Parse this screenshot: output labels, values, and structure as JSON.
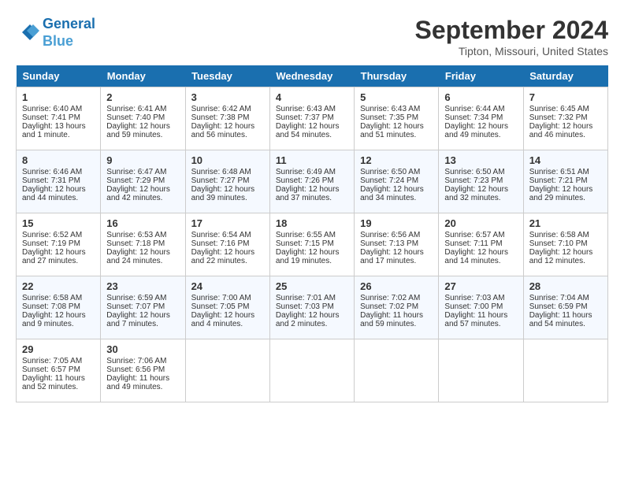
{
  "header": {
    "logo_line1": "General",
    "logo_line2": "Blue",
    "month": "September 2024",
    "location": "Tipton, Missouri, United States"
  },
  "days_of_week": [
    "Sunday",
    "Monday",
    "Tuesday",
    "Wednesday",
    "Thursday",
    "Friday",
    "Saturday"
  ],
  "weeks": [
    [
      {
        "day": "1",
        "info": "Sunrise: 6:40 AM\nSunset: 7:41 PM\nDaylight: 13 hours\nand 1 minute."
      },
      {
        "day": "2",
        "info": "Sunrise: 6:41 AM\nSunset: 7:40 PM\nDaylight: 12 hours\nand 59 minutes."
      },
      {
        "day": "3",
        "info": "Sunrise: 6:42 AM\nSunset: 7:38 PM\nDaylight: 12 hours\nand 56 minutes."
      },
      {
        "day": "4",
        "info": "Sunrise: 6:43 AM\nSunset: 7:37 PM\nDaylight: 12 hours\nand 54 minutes."
      },
      {
        "day": "5",
        "info": "Sunrise: 6:43 AM\nSunset: 7:35 PM\nDaylight: 12 hours\nand 51 minutes."
      },
      {
        "day": "6",
        "info": "Sunrise: 6:44 AM\nSunset: 7:34 PM\nDaylight: 12 hours\nand 49 minutes."
      },
      {
        "day": "7",
        "info": "Sunrise: 6:45 AM\nSunset: 7:32 PM\nDaylight: 12 hours\nand 46 minutes."
      }
    ],
    [
      {
        "day": "8",
        "info": "Sunrise: 6:46 AM\nSunset: 7:31 PM\nDaylight: 12 hours\nand 44 minutes."
      },
      {
        "day": "9",
        "info": "Sunrise: 6:47 AM\nSunset: 7:29 PM\nDaylight: 12 hours\nand 42 minutes."
      },
      {
        "day": "10",
        "info": "Sunrise: 6:48 AM\nSunset: 7:27 PM\nDaylight: 12 hours\nand 39 minutes."
      },
      {
        "day": "11",
        "info": "Sunrise: 6:49 AM\nSunset: 7:26 PM\nDaylight: 12 hours\nand 37 minutes."
      },
      {
        "day": "12",
        "info": "Sunrise: 6:50 AM\nSunset: 7:24 PM\nDaylight: 12 hours\nand 34 minutes."
      },
      {
        "day": "13",
        "info": "Sunrise: 6:50 AM\nSunset: 7:23 PM\nDaylight: 12 hours\nand 32 minutes."
      },
      {
        "day": "14",
        "info": "Sunrise: 6:51 AM\nSunset: 7:21 PM\nDaylight: 12 hours\nand 29 minutes."
      }
    ],
    [
      {
        "day": "15",
        "info": "Sunrise: 6:52 AM\nSunset: 7:19 PM\nDaylight: 12 hours\nand 27 minutes."
      },
      {
        "day": "16",
        "info": "Sunrise: 6:53 AM\nSunset: 7:18 PM\nDaylight: 12 hours\nand 24 minutes."
      },
      {
        "day": "17",
        "info": "Sunrise: 6:54 AM\nSunset: 7:16 PM\nDaylight: 12 hours\nand 22 minutes."
      },
      {
        "day": "18",
        "info": "Sunrise: 6:55 AM\nSunset: 7:15 PM\nDaylight: 12 hours\nand 19 minutes."
      },
      {
        "day": "19",
        "info": "Sunrise: 6:56 AM\nSunset: 7:13 PM\nDaylight: 12 hours\nand 17 minutes."
      },
      {
        "day": "20",
        "info": "Sunrise: 6:57 AM\nSunset: 7:11 PM\nDaylight: 12 hours\nand 14 minutes."
      },
      {
        "day": "21",
        "info": "Sunrise: 6:58 AM\nSunset: 7:10 PM\nDaylight: 12 hours\nand 12 minutes."
      }
    ],
    [
      {
        "day": "22",
        "info": "Sunrise: 6:58 AM\nSunset: 7:08 PM\nDaylight: 12 hours\nand 9 minutes."
      },
      {
        "day": "23",
        "info": "Sunrise: 6:59 AM\nSunset: 7:07 PM\nDaylight: 12 hours\nand 7 minutes."
      },
      {
        "day": "24",
        "info": "Sunrise: 7:00 AM\nSunset: 7:05 PM\nDaylight: 12 hours\nand 4 minutes."
      },
      {
        "day": "25",
        "info": "Sunrise: 7:01 AM\nSunset: 7:03 PM\nDaylight: 12 hours\nand 2 minutes."
      },
      {
        "day": "26",
        "info": "Sunrise: 7:02 AM\nSunset: 7:02 PM\nDaylight: 11 hours\nand 59 minutes."
      },
      {
        "day": "27",
        "info": "Sunrise: 7:03 AM\nSunset: 7:00 PM\nDaylight: 11 hours\nand 57 minutes."
      },
      {
        "day": "28",
        "info": "Sunrise: 7:04 AM\nSunset: 6:59 PM\nDaylight: 11 hours\nand 54 minutes."
      }
    ],
    [
      {
        "day": "29",
        "info": "Sunrise: 7:05 AM\nSunset: 6:57 PM\nDaylight: 11 hours\nand 52 minutes."
      },
      {
        "day": "30",
        "info": "Sunrise: 7:06 AM\nSunset: 6:56 PM\nDaylight: 11 hours\nand 49 minutes."
      },
      null,
      null,
      null,
      null,
      null
    ]
  ]
}
